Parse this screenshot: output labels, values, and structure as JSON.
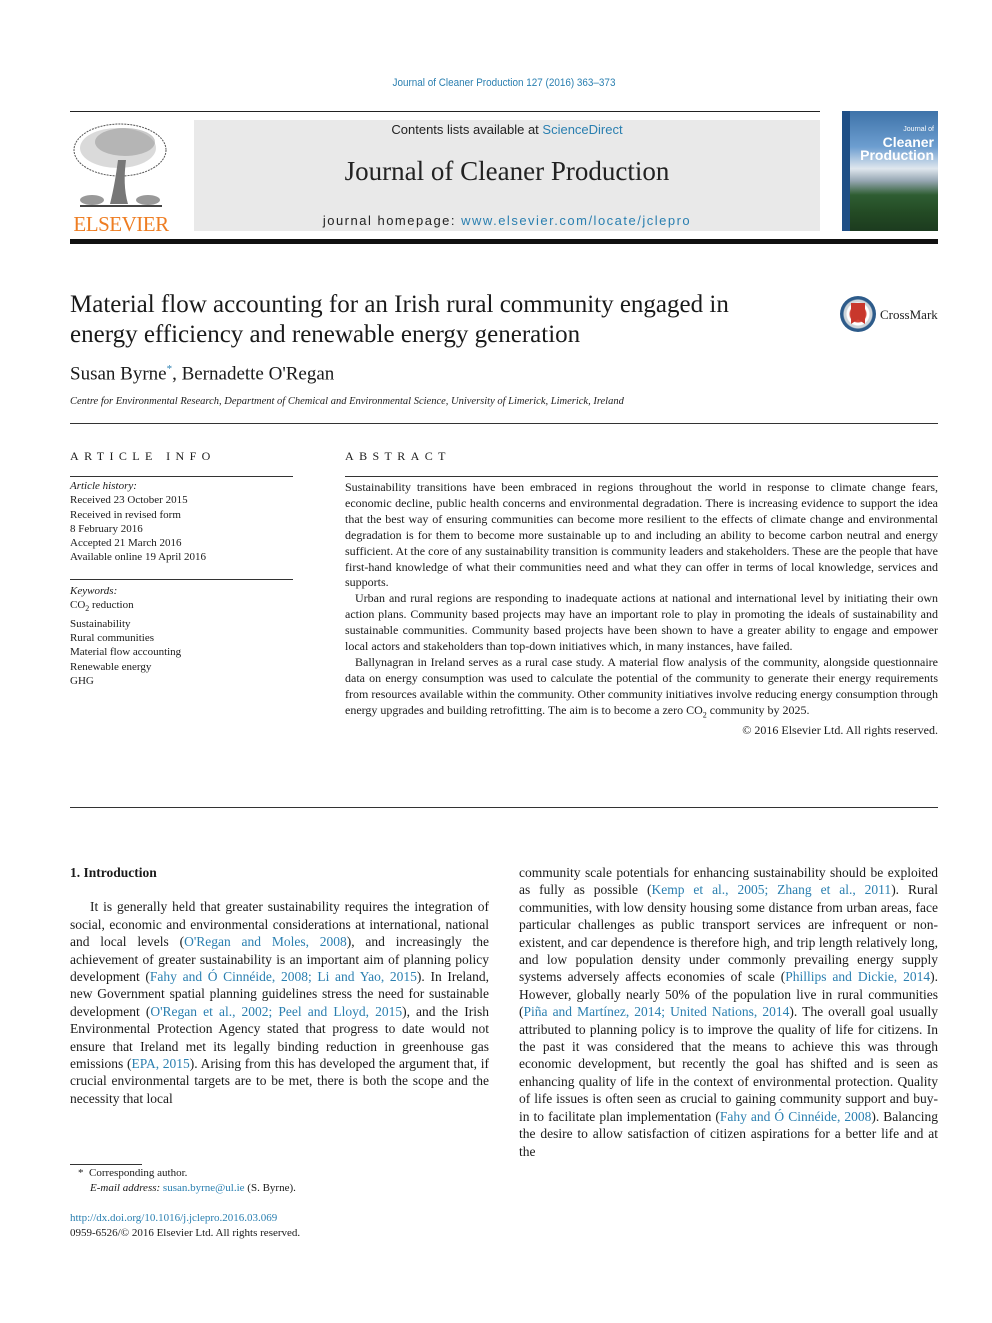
{
  "header": {
    "journal_reference": "Journal of Cleaner Production 127 (2016) 363–373",
    "contents_prefix": "Contents lists available at ",
    "contents_link": "ScienceDirect",
    "journal_name": "Journal of Cleaner Production",
    "homepage_prefix": "journal homepage: ",
    "homepage_link": "www.elsevier.com/locate/jclepro",
    "publisher_logo": "ELSEVIER",
    "cover": {
      "small": "Journal of",
      "line1": "Cleaner",
      "line2": "Production"
    },
    "colors": {
      "link": "#2a7fb0",
      "publisher_orange": "#ee7d22",
      "masthead_bg": "#e9e9e9"
    }
  },
  "article": {
    "title": "Material flow accounting for an Irish rural community engaged in energy efficiency and renewable energy generation",
    "crossmark_label": "CrossMark",
    "authors": [
      {
        "name": "Susan Byrne",
        "marker": "*"
      },
      {
        "name": "Bernadette O'Regan",
        "marker": ""
      }
    ],
    "author_separator": ", ",
    "affiliation": "Centre for Environmental Research, Department of Chemical and Environmental Science, University of Limerick, Limerick, Ireland"
  },
  "article_info": {
    "heading": "ARTICLE INFO",
    "history_label": "Article history:",
    "history": [
      "Received 23 October 2015",
      "Received in revised form",
      "8 February 2016",
      "Accepted 21 March 2016",
      "Available online 19 April 2016"
    ],
    "keywords_label": "Keywords:",
    "keywords": [
      {
        "pre": "CO",
        "sub": "2",
        "post": " reduction"
      },
      {
        "pre": "Sustainability",
        "sub": "",
        "post": ""
      },
      {
        "pre": "Rural communities",
        "sub": "",
        "post": ""
      },
      {
        "pre": "Material flow accounting",
        "sub": "",
        "post": ""
      },
      {
        "pre": "Renewable energy",
        "sub": "",
        "post": ""
      },
      {
        "pre": "GHG",
        "sub": "",
        "post": ""
      }
    ]
  },
  "abstract": {
    "heading": "ABSTRACT",
    "paragraphs": [
      "Sustainability transitions have been embraced in regions throughout the world in response to climate change fears, economic decline, public health concerns and environmental degradation. There is increasing evidence to support the idea that the best way of ensuring communities can become more resilient to the effects of climate change and environmental degradation is for them to become more sustainable up to and including an ability to become carbon neutral and energy sufficient. At the core of any sustainability transition is community leaders and stakeholders. These are the people that have first-hand knowledge of what their communities need and what they can offer in terms of local knowledge, services and supports.",
      "Urban and rural regions are responding to inadequate actions at national and international level by initiating their own action plans. Community based projects may have an important role to play in promoting the ideals of sustainability and sustainable communities. Community based projects have been shown to have a greater ability to engage and empower local actors and stakeholders than top-down initiatives which, in many instances, have failed."
    ],
    "last_paragraph_pre": "Ballynagran in Ireland serves as a rural case study. A material flow analysis of the community, alongside questionnaire data on energy consumption was used to calculate the potential of the community to generate their energy requirements from resources available within the community. Other community initiatives involve reducing energy consumption through energy upgrades and building retrofitting. The aim is to become a zero CO",
    "last_paragraph_sub": "2",
    "last_paragraph_post": " community by 2025.",
    "copyright": "© 2016 Elsevier Ltd. All rights reserved."
  },
  "body": {
    "section_title": "1.  Introduction",
    "left_column": [
      {
        "t": "It is generally held that greater sustainability requires the integration of social, economic and environmental considerations at international, national and local levels ("
      },
      {
        "link": "O'Regan and Moles, 2008"
      },
      {
        "t": "), and increasingly the achievement of greater sustainability is an important aim of planning policy development ("
      },
      {
        "link": "Fahy and Ó Cinnéide, 2008; Li and Yao, 2015"
      },
      {
        "t": "). In Ireland, new Government spatial planning guidelines stress the need for sustainable development ("
      },
      {
        "link": "O'Regan et al., 2002; Peel and Lloyd, 2015"
      },
      {
        "t": "), and the Irish Environmental Protection Agency stated that progress to date would not ensure that Ireland met its legally binding reduction in greenhouse gas emissions ("
      },
      {
        "link": "EPA, 2015"
      },
      {
        "t": "). Arising from this has developed the argument that, if crucial environmental targets are to be met, there is both the scope and the necessity that local"
      }
    ],
    "right_column": [
      {
        "t": "community scale potentials for enhancing sustainability should be exploited as fully as possible ("
      },
      {
        "link": "Kemp et al., 2005; Zhang et al., 2011"
      },
      {
        "t": "). Rural communities, with low density housing some distance from urban areas, face particular challenges as public transport services are infrequent or non-existent, and car dependence is therefore high, and trip length relatively long, and low population density under commonly prevailing energy supply systems adversely affects economies of scale ("
      },
      {
        "link": "Phillips and Dickie, 2014"
      },
      {
        "t": "). However, globally nearly 50% of the population live in rural communities ("
      },
      {
        "link": "Piña and Martínez, 2014; United Nations, 2014"
      },
      {
        "t": "). The overall goal usually attributed to planning policy is to improve the quality of life for citizens. In the past it was considered that the means to achieve this was through economic development, but recently the goal has shifted and is seen as enhancing quality of life in the context of environmental protection. Quality of life issues is often seen as crucial to gaining community support and buy-in to facilitate plan implementation ("
      },
      {
        "link": "Fahy and Ó Cinnéide, 2008"
      },
      {
        "t": "). Balancing the desire to allow satisfaction of citizen aspirations for a better life and at the"
      }
    ]
  },
  "footnote": {
    "marker": "*",
    "corresponding": "Corresponding author.",
    "email_label": "E-mail address: ",
    "email": "susan.byrne@ul.ie",
    "email_suffix": " (S. Byrne)."
  },
  "doi": {
    "link": "http://dx.doi.org/10.1016/j.jclepro.2016.03.069",
    "issn_copyright": "0959-6526/© 2016 Elsevier Ltd. All rights reserved."
  }
}
